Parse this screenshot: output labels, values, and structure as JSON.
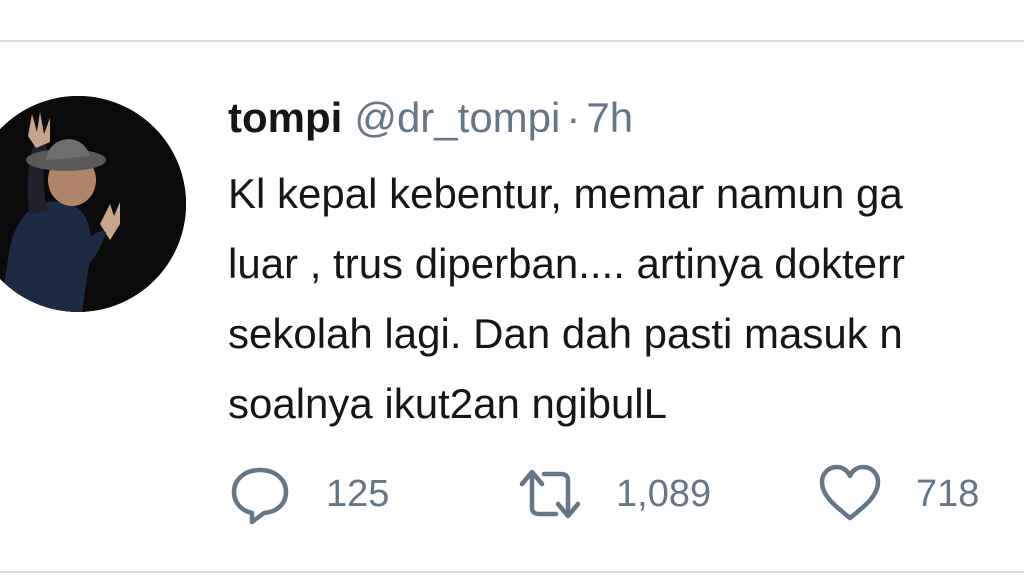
{
  "tweet": {
    "display_name": "tompi",
    "handle": "@dr_tompi",
    "separator": "·",
    "time": "7h",
    "avatar_icon": "profile-photo",
    "text_lines": [
      "Kl kepal kebentur, memar namun ga",
      "luar , trus diperban.... artinya dokterr",
      "sekolah lagi. Dan dah pasti masuk n",
      "soalnya ikut2an ngibulL"
    ],
    "actions": {
      "reply": {
        "icon": "reply-icon",
        "count": "125"
      },
      "retweet": {
        "icon": "retweet-icon",
        "count": "1,089"
      },
      "like": {
        "icon": "heart-icon",
        "count": "718"
      }
    }
  },
  "colors": {
    "text": "#14171a",
    "secondary": "#657786",
    "divider": "#d6dadd",
    "background": "#ffffff"
  }
}
